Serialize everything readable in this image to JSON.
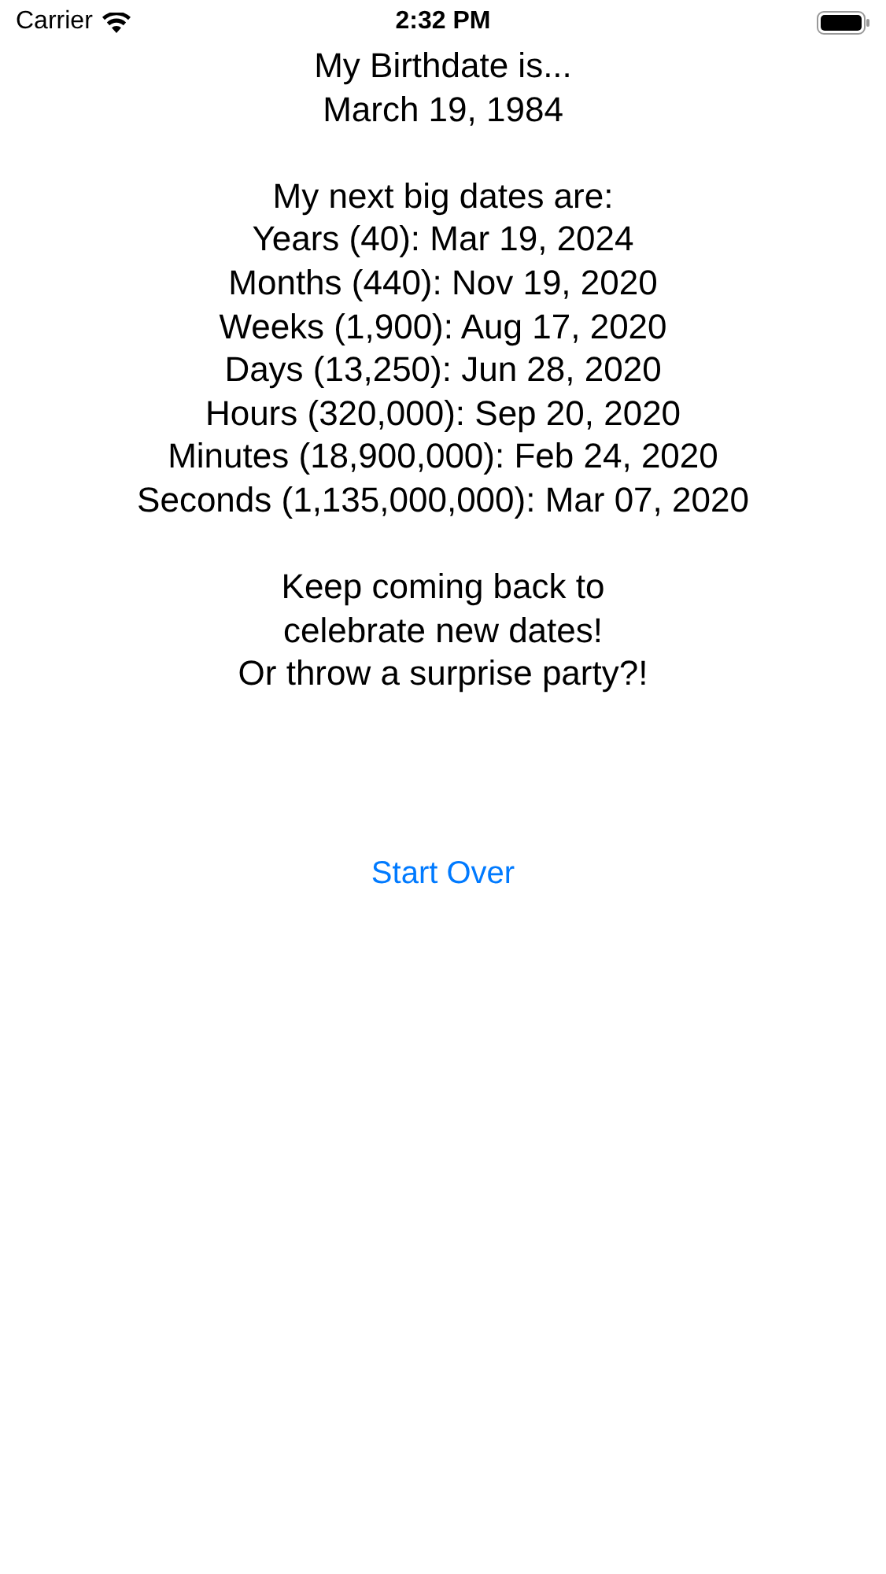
{
  "status_bar": {
    "carrier": "Carrier",
    "time": "2:32 PM"
  },
  "birthdate": [
    "My Birthdate is...",
    "March 19, 1984"
  ],
  "big_dates": [
    "My next big dates are:",
    "Years (40): Mar 19, 2024",
    "Months (440): Nov 19, 2020",
    "Weeks (1,900): Aug 17, 2020",
    "Days (13,250): Jun 28, 2020",
    "Hours (320,000): Sep 20, 2020",
    "Minutes (18,900,000): Feb 24, 2020",
    "Seconds (1,135,000,000): Mar 07, 2020"
  ],
  "message": [
    "Keep coming back to",
    "celebrate new dates!",
    "Or throw a surprise party?!"
  ],
  "start_over_button": "Start Over"
}
